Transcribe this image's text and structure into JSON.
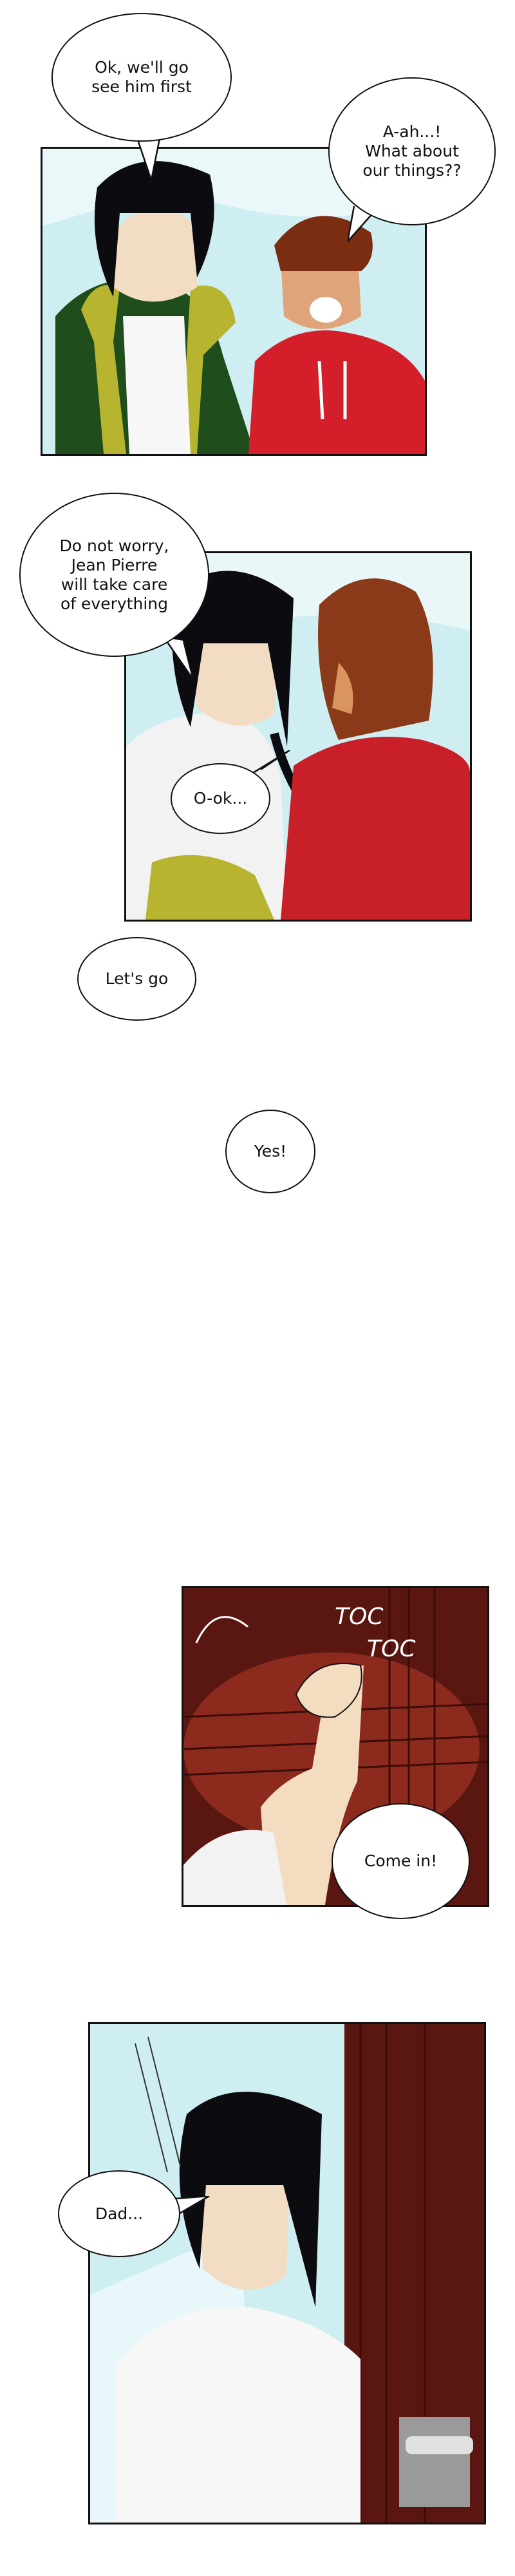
{
  "panels": [
    {
      "speech": [
        {
          "text": "Ok, we'll go\nsee him first"
        },
        {
          "text": "A-ah...!\nWhat about\nour things??"
        }
      ]
    },
    {
      "speech": [
        {
          "text": "Do not worry,\nJean Pierre\nwill take care\nof everything"
        },
        {
          "text": "O-ok..."
        }
      ]
    },
    {
      "speech": [
        {
          "text": "Let's go"
        },
        {
          "text": "Yes!"
        }
      ]
    },
    {
      "sfx": [
        "TOC",
        "TOC"
      ],
      "speech": [
        {
          "text": "Come in!"
        }
      ]
    },
    {
      "speech": [
        {
          "text": "Dad..."
        }
      ]
    }
  ],
  "colors": {
    "jacket": "#1f4d1c",
    "fur": "#b7b530",
    "hoodie": "#d41f2a",
    "door": "#5a1610",
    "sky": "#cfeef2"
  }
}
